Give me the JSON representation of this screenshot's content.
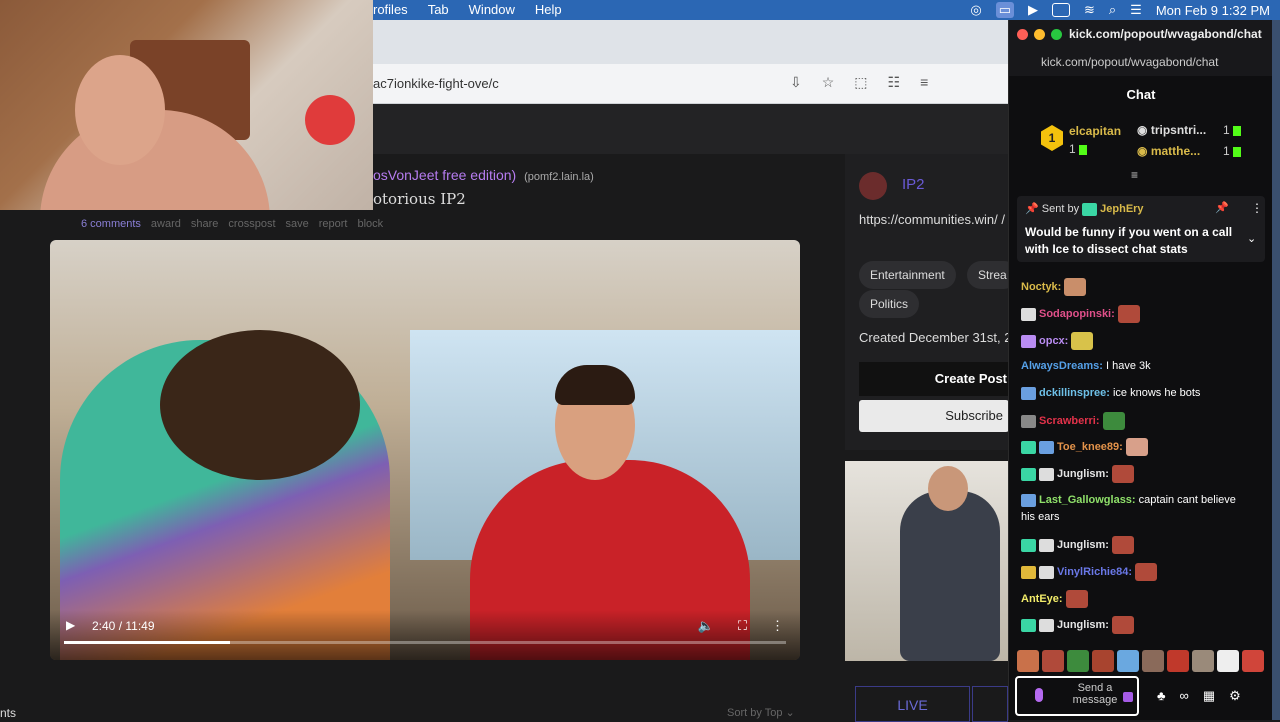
{
  "menubar": {
    "items": [
      "rofiles",
      "Tab",
      "Window",
      "Help"
    ],
    "datetime": "Mon Feb 9  1:32 PM"
  },
  "browser": {
    "url": "ac7ionkike-fight-ove/c"
  },
  "post": {
    "title_fragment": "osVonJeet free edition)",
    "source": "(pomf2.lain.la)",
    "subtitle_fragment": "otorious IP2",
    "actions": [
      "6 comments",
      "award",
      "share",
      "crosspost",
      "save",
      "report",
      "block"
    ]
  },
  "video": {
    "time": "2:40 / 11:49",
    "progress": 0.23
  },
  "page_bottom": {
    "left_text": "nts",
    "sort_label": "Sort by Top"
  },
  "community": {
    "name": "IP2",
    "url": "https://communities.win/ /",
    "tags": [
      "Entertainment",
      "Strea",
      "Politics"
    ],
    "created": "Created December 31st, 2",
    "create_post": "Create Post",
    "subscribe": "Subscribe",
    "live": "LIVE"
  },
  "chat": {
    "window_title": "kick.com/popout/wvagabond/chat",
    "url": "kick.com/popout/wvagabond/chat",
    "header": "Chat",
    "leaderboard": [
      {
        "rank": "1",
        "name": "elcapitan",
        "count": "1"
      },
      {
        "rank": "2",
        "name": "tripsntri...",
        "count": "1"
      },
      {
        "rank": "3",
        "name": "matthe...",
        "count": "1"
      }
    ],
    "pinned": {
      "sent_by_label": "Sent by",
      "sender": "JephEry",
      "message": "Would be funny if you went on a call with Ice to dissect chat stats"
    },
    "messages": [
      {
        "user": "Noctyk:",
        "text": "",
        "color": "#d9ba4a"
      },
      {
        "user": "Sodapopinski:",
        "text": "",
        "color": "#e0508a"
      },
      {
        "user": "opcx:",
        "text": "",
        "color": "#b98cf2"
      },
      {
        "user": "AlwaysDreams:",
        "text": "I have 3k",
        "color": "#55a0e8"
      },
      {
        "user": "dckillinspree:",
        "text": "ice knows he bots",
        "color": "#6ec0e8"
      },
      {
        "user": "Scrawberri:",
        "text": "",
        "color": "#e2324a"
      },
      {
        "user": "Toe_knee89:",
        "text": "",
        "color": "#e2924a"
      },
      {
        "user": "Junglism:",
        "text": "",
        "color": "#e5e5e5"
      },
      {
        "user": "Last_Gallowglass:",
        "text": "captain cant believe",
        "color": "#8fe06a"
      },
      {
        "user": "",
        "text": "his ears",
        "color": "#ffffff"
      },
      {
        "user": "Junglism:",
        "text": "",
        "color": "#e5e5e5"
      },
      {
        "user": "VinylRichie84:",
        "text": "",
        "color": "#6a78e8"
      },
      {
        "user": "AntEye:",
        "text": "",
        "color": "#f2ec6a"
      },
      {
        "user": "Junglism:",
        "text": "",
        "color": "#e5e5e5"
      }
    ],
    "input_placeholder": "Send a message"
  }
}
